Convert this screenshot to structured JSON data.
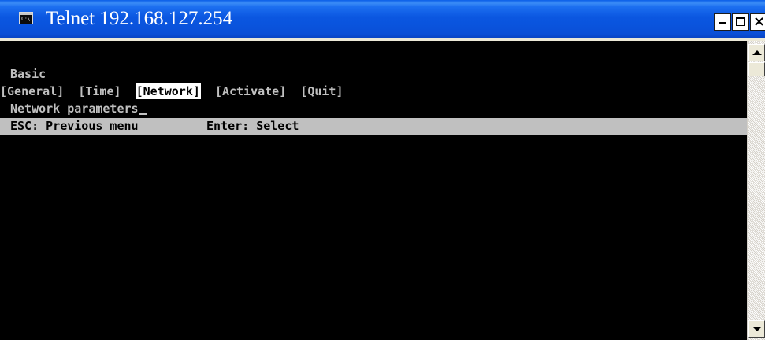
{
  "window": {
    "title": "Telnet 192.168.127.254",
    "icon": "console-icon",
    "icon_glyph": "C:\\"
  },
  "controls": {
    "minimize_icon": "minimize-icon",
    "maximize_icon": "maximize-icon",
    "close_icon": "close-icon",
    "close_glyph": "×"
  },
  "console": {
    "heading": "Basic",
    "menu": [
      {
        "label": "[General]",
        "selected": false
      },
      {
        "label": "[Time]",
        "selected": false
      },
      {
        "label": "[Network]",
        "selected": true
      },
      {
        "label": "[Activate]",
        "selected": false
      },
      {
        "label": "[Quit]",
        "selected": false
      }
    ],
    "description": "Network parameters",
    "status": {
      "esc": "ESC: Previous menu",
      "enter": "Enter: Select"
    }
  },
  "colors": {
    "titlebar": "#0b57e1",
    "console_bg": "#000000",
    "console_fg": "#c0c0c0",
    "status_bg": "#c0c0c0",
    "selected_bg": "#ffffff"
  }
}
